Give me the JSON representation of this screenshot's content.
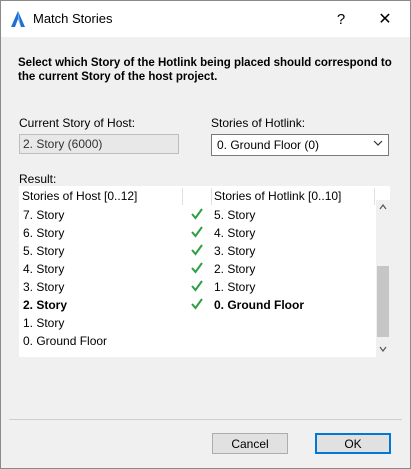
{
  "window": {
    "title": "Match Stories",
    "help": "?",
    "close": "✕"
  },
  "instruction": "Select which Story of the Hotlink being placed should correspond to the current Story of the host project.",
  "current_story": {
    "label": "Current Story of Host:",
    "value": "2. Story (6000)"
  },
  "hotlink_stories": {
    "label": "Stories of Hotlink:",
    "selected": "0. Ground Floor (0)"
  },
  "result": {
    "label": "Result:",
    "host_header": "Stories of Host [0..12]",
    "hotlink_header": "Stories of Hotlink [0..10]",
    "rows": [
      {
        "host": "7. Story",
        "hotlink": "5. Story",
        "matched": true
      },
      {
        "host": "6. Story",
        "hotlink": "4. Story",
        "matched": true
      },
      {
        "host": "5. Story",
        "hotlink": "3. Story",
        "matched": true
      },
      {
        "host": "4. Story",
        "hotlink": "2. Story",
        "matched": true
      },
      {
        "host": "3. Story",
        "hotlink": "1. Story",
        "matched": true
      },
      {
        "host": "2. Story",
        "hotlink": "0. Ground Floor",
        "matched": true,
        "current": true
      },
      {
        "host": "1. Story",
        "hotlink": "",
        "matched": false
      },
      {
        "host": "0. Ground Floor",
        "hotlink": "",
        "matched": false
      }
    ]
  },
  "buttons": {
    "cancel": "Cancel",
    "ok": "OK"
  },
  "colors": {
    "check": "#2ea043",
    "accent": "#0078d7"
  }
}
